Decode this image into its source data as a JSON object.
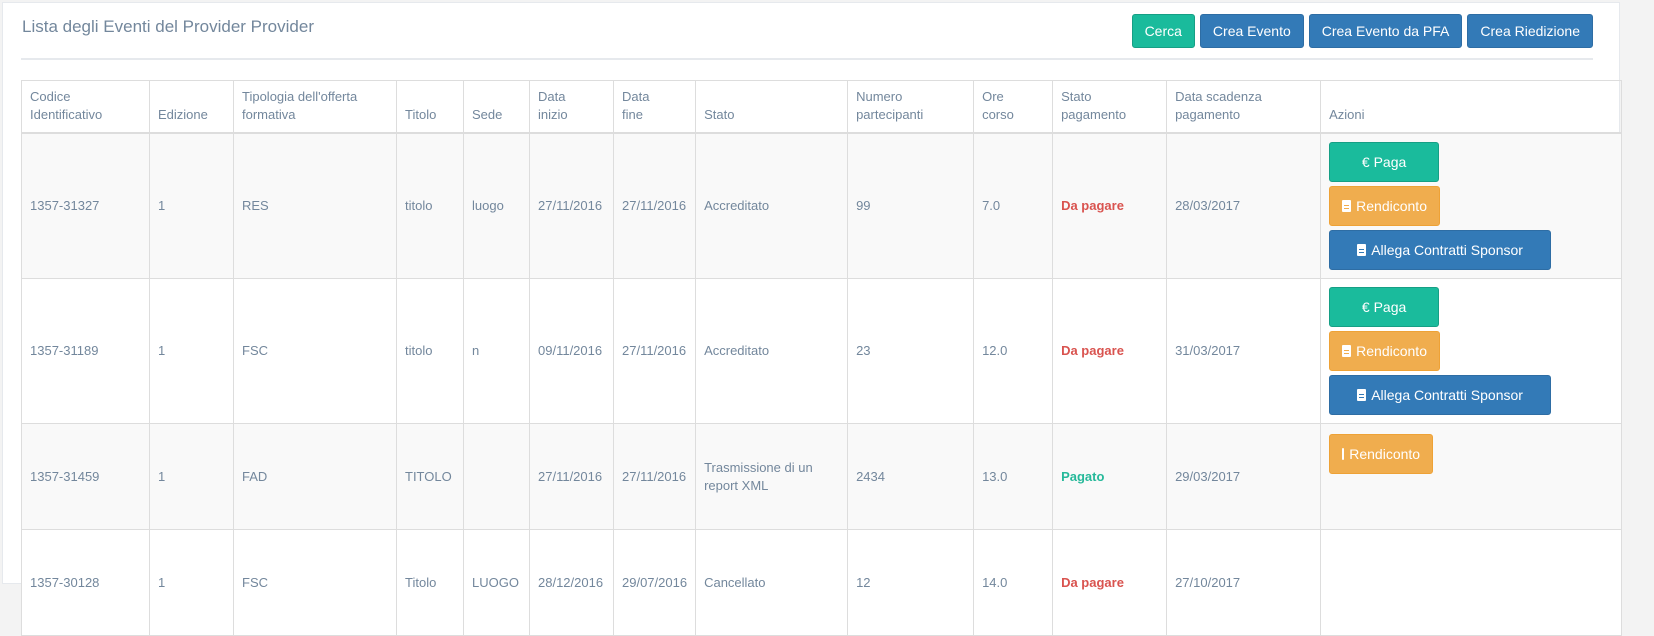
{
  "header": {
    "title": "Lista degli Eventi del Provider Provider",
    "buttons": {
      "cerca": "Cerca",
      "crea_evento": "Crea Evento",
      "crea_evento_pfa": "Crea Evento da PFA",
      "crea_riedizione": "Crea Riedizione"
    }
  },
  "table": {
    "columns": [
      "Codice\nIdentificativo",
      "Edizione",
      "Tipologia dell'offerta\nformativa",
      "Titolo",
      "Sede",
      "Data\ninizio",
      "Data\nfine",
      "Stato",
      "Numero\npartecipanti",
      "Ore\ncorso",
      "Stato\npagamento",
      "Data scadenza\npagamento",
      "Azioni"
    ],
    "rows": [
      {
        "codice": "1357-31327",
        "edizione": "1",
        "tipologia": "RES",
        "titolo": "titolo",
        "sede": "luogo",
        "data_inizio": "27/11/2016",
        "data_fine": "27/11/2016",
        "stato": "Accreditato",
        "partecipanti": "99",
        "ore": "7.0",
        "stato_pagamento": "Da pagare",
        "scadenza": "28/03/2017"
      },
      {
        "codice": "1357-31189",
        "edizione": "1",
        "tipologia": "FSC",
        "titolo": "titolo",
        "sede": "n",
        "data_inizio": "09/11/2016",
        "data_fine": "27/11/2016",
        "stato": "Accreditato",
        "partecipanti": "23",
        "ore": "12.0",
        "stato_pagamento": "Da pagare",
        "scadenza": "31/03/2017"
      },
      {
        "codice": "1357-31459",
        "edizione": "1",
        "tipologia": "FAD",
        "titolo": "TITOLO",
        "sede": "",
        "data_inizio": "27/11/2016",
        "data_fine": "27/11/2016",
        "stato": "Trasmissione di un\nreport XML",
        "partecipanti": "2434",
        "ore": "13.0",
        "stato_pagamento": "Pagato",
        "scadenza": "29/03/2017"
      },
      {
        "codice": "1357-30128",
        "edizione": "1",
        "tipologia": "FSC",
        "titolo": "Titolo",
        "sede": "LUOGO",
        "data_inizio": "28/12/2016",
        "data_fine": "29/07/2016",
        "stato": "Cancellato",
        "partecipanti": "12",
        "ore": "14.0",
        "stato_pagamento": "Da pagare",
        "scadenza": "27/10/2017"
      }
    ],
    "actions": {
      "paga": "€ Paga",
      "rendiconto": "Rendiconto",
      "allega": "Allega Contratti Sponsor"
    }
  },
  "colors": {
    "success": "#1abb9c",
    "primary": "#337ab7",
    "warning": "#f0ad4e",
    "danger_text": "#d9534f",
    "paid_text": "#26b99a"
  }
}
